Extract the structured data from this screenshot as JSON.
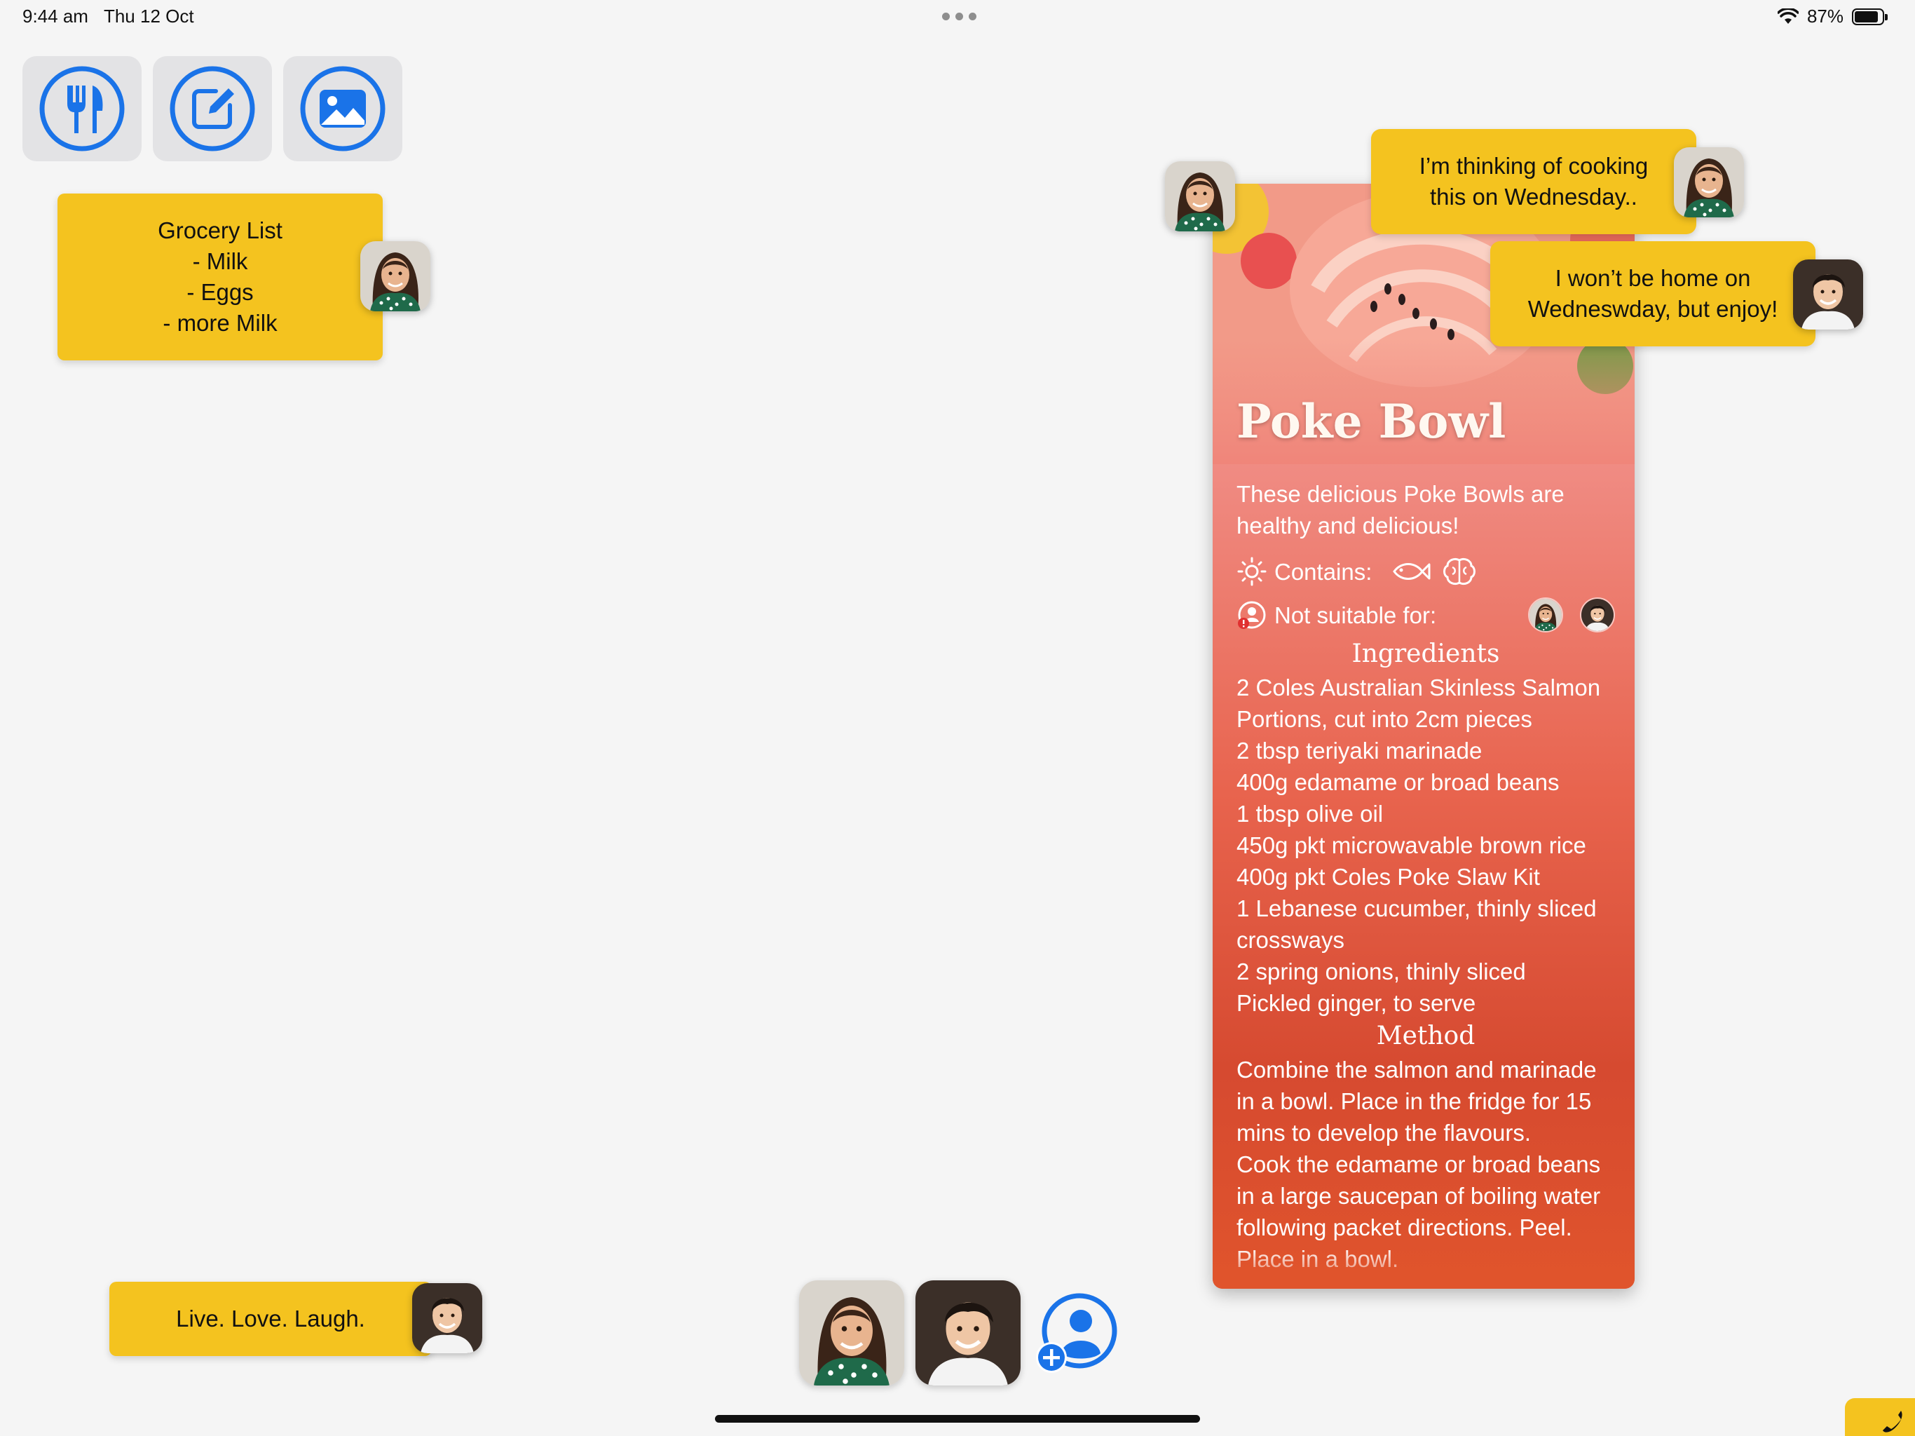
{
  "status_bar": {
    "time": "9:44 am",
    "date": "Thu 12 Oct",
    "battery": "87%",
    "battery_level": 0.87
  },
  "toolbar": {
    "buttons": [
      {
        "icon": "fork-knife-icon"
      },
      {
        "icon": "pencil-square-icon"
      },
      {
        "icon": "photo-icon"
      }
    ]
  },
  "grocery_note": {
    "lines": [
      "Grocery List",
      "- Milk",
      "- Eggs",
      "- more Milk"
    ]
  },
  "quote_note": {
    "text": "Live. Love. Laugh."
  },
  "recipe": {
    "title": "Poke Bowl",
    "description": "These delicious Poke Bowls are healthy and delicious!",
    "contains_label": "Contains:",
    "contains_icons": [
      "fish-icon",
      "brain-icon"
    ],
    "not_suitable_label": "Not suitable for:",
    "ingredients_heading": "Ingredients",
    "ingredients": [
      "2 Coles Australian Skinless Salmon Portions, cut into 2cm pieces",
      "2 tbsp teriyaki marinade",
      "400g edamame or broad beans",
      "1 tbsp olive oil",
      "450g pkt microwavable brown rice",
      "400g pkt Coles Poke Slaw Kit",
      "1 Lebanese cucumber, thinly sliced crossways",
      "2 spring onions, thinly sliced",
      "Pickled ginger, to serve"
    ],
    "method_heading": "Method",
    "method": [
      "Combine the salmon and marinade in a bowl. Place in the fridge for 15 mins to develop the flavours.",
      "Cook the edamame or broad beans in a large saucepan of boiling water following packet directions. Peel. Place in a bowl."
    ]
  },
  "messages": [
    {
      "text": "I’m thinking of cooking this on Wednesday..",
      "author": "woman"
    },
    {
      "text": "I won’t be home on Wedneswday, but enjoy!",
      "author": "man"
    }
  ],
  "colors": {
    "note": "#f4c31f",
    "accent": "#1a73e8",
    "background": "#f5f5f5"
  }
}
